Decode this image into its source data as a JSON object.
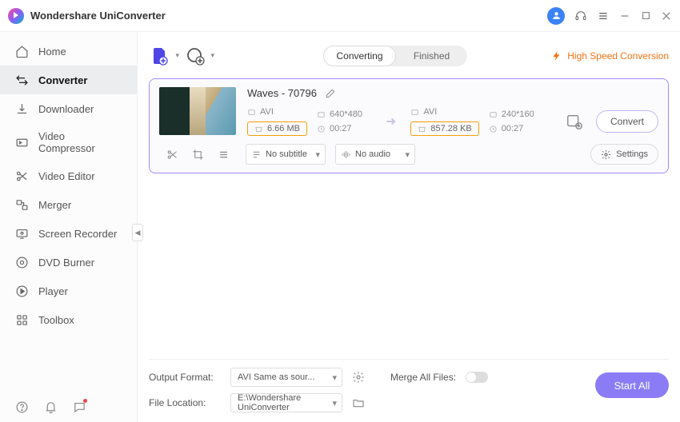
{
  "app": {
    "title": "Wondershare UniConverter"
  },
  "sidebar": {
    "items": [
      {
        "label": "Home"
      },
      {
        "label": "Converter"
      },
      {
        "label": "Downloader"
      },
      {
        "label": "Video Compressor"
      },
      {
        "label": "Video Editor"
      },
      {
        "label": "Merger"
      },
      {
        "label": "Screen Recorder"
      },
      {
        "label": "DVD Burner"
      },
      {
        "label": "Player"
      },
      {
        "label": "Toolbox"
      }
    ]
  },
  "tabs": {
    "converting": "Converting",
    "finished": "Finished"
  },
  "hsc": "High Speed Conversion",
  "file": {
    "title": "Waves - 70796",
    "src": {
      "format": "AVI",
      "res": "640*480",
      "size": "6.66 MB",
      "dur": "00:27"
    },
    "dst": {
      "format": "AVI",
      "res": "240*160",
      "size": "857.28 KB",
      "dur": "00:27"
    },
    "subtitle": "No subtitle",
    "audio": "No audio",
    "settings": "Settings",
    "convert": "Convert"
  },
  "bottom": {
    "outfmt_label": "Output Format:",
    "outfmt_value": "AVI Same as sour...",
    "merge_label": "Merge All Files:",
    "loc_label": "File Location:",
    "loc_value": "E:\\Wondershare UniConverter",
    "startall": "Start All"
  }
}
